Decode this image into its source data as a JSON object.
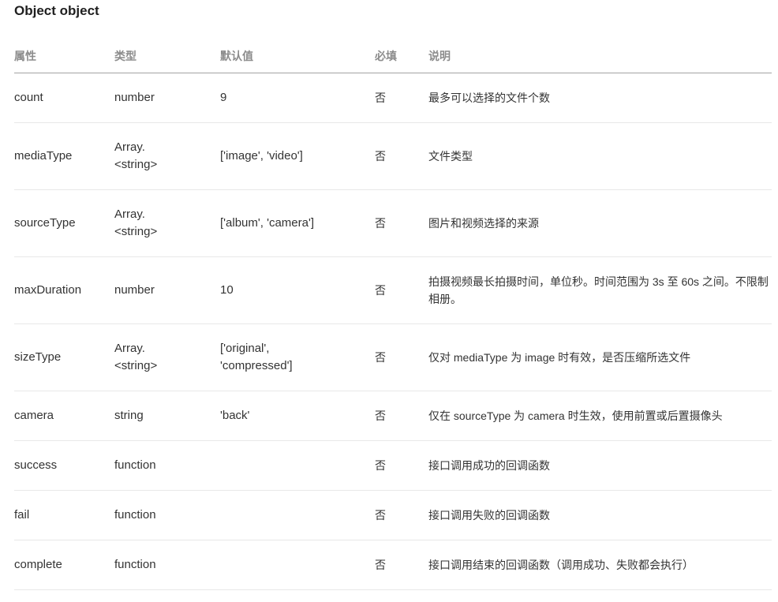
{
  "title": "Object object",
  "table": {
    "headers": {
      "name": "属性",
      "type": "类型",
      "default": "默认值",
      "required": "必填",
      "description": "说明"
    },
    "rows": [
      {
        "name": "count",
        "type": "number",
        "default": "9",
        "required": "否",
        "description": "最多可以选择的文件个数"
      },
      {
        "name": "mediaType",
        "type": "Array.<string>",
        "default": "['image', 'video']",
        "required": "否",
        "description": "文件类型"
      },
      {
        "name": "sourceType",
        "type": "Array.<string>",
        "default": "['album', 'camera']",
        "required": "否",
        "description": "图片和视频选择的来源"
      },
      {
        "name": "maxDuration",
        "type": "number",
        "default": "10",
        "required": "否",
        "description": "拍摄视频最长拍摄时间，单位秒。时间范围为 3s 至 60s 之间。不限制相册。"
      },
      {
        "name": "sizeType",
        "type": "Array.<string>",
        "default": "['original', 'compressed']",
        "required": "否",
        "description": "仅对 mediaType 为 image 时有效，是否压缩所选文件"
      },
      {
        "name": "camera",
        "type": "string",
        "default": "'back'",
        "required": "否",
        "description": "仅在 sourceType 为 camera 时生效，使用前置或后置摄像头"
      },
      {
        "name": "success",
        "type": "function",
        "required": "否",
        "description": "接口调用成功的回调函数"
      },
      {
        "name": "fail",
        "type": "function",
        "required": "否",
        "description": "接口调用失败的回调函数"
      },
      {
        "name": "complete",
        "type": "function",
        "required": "否",
        "description": "接口调用结束的回调函数（调用成功、失败都会执行）"
      }
    ]
  }
}
